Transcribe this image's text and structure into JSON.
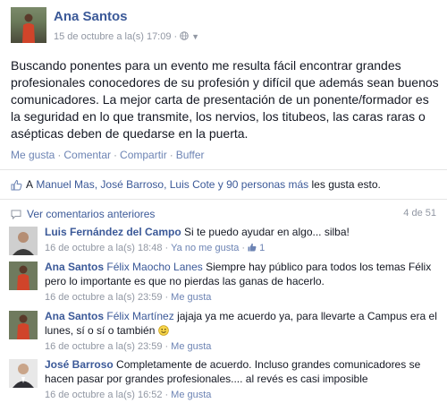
{
  "post": {
    "author": "Ana Santos",
    "timestamp": "15 de octubre a la(s) 17:09",
    "separator": "·",
    "text": "Buscando ponentes para un evento me resulta fácil encontrar grandes profesionales conocedores de su profesión y difícil que además sean buenos comunicadores. La mejor carta de presentación de un ponente/formador es la seguridad en lo que transmite, los nervios, los titubeos, las caras raras o asépticas deben de quedarse en la puerta.",
    "actions": [
      "Me gusta",
      "Comentar",
      "Compartir",
      "Buffer"
    ],
    "likes_prefix": "A",
    "likes_names": "Manuel Mas, José Barroso, Luis Cote y 90 personas más",
    "likes_suffix": "les gusta esto.",
    "view_previous": "Ver comentarios anteriores",
    "comment_count": "4 de 51"
  },
  "comments": [
    {
      "author": "Luis Fernández del Campo",
      "tag": "",
      "text": "Si te puedo ayudar en algo... silba!",
      "timestamp": "16 de octubre a la(s) 18:48",
      "action": "Ya no me gusta",
      "likes": "1"
    },
    {
      "author": "Ana Santos",
      "tag": "Félix Maocho Lanes",
      "text": "Siempre hay público para todos los temas Félix pero lo importante es que no pierdas las ganas de hacerlo.",
      "timestamp": "16 de octubre a la(s) 23:59",
      "action": "Me gusta"
    },
    {
      "author": "Ana Santos",
      "tag": "Félix Martínez",
      "text": "jajaja ya me acuerdo ya, para llevarte a Campus era el lunes, sí o sí o también",
      "timestamp": "16 de octubre a la(s) 23:59",
      "action": "Me gusta"
    },
    {
      "author": "José Barroso",
      "tag": "",
      "text": "Completamente de acuerdo. Incluso grandes comunicadores se hacen pasar por grandes profesionales.... al revés es casi imposible",
      "timestamp": "16 de octubre a la(s) 16:52",
      "action": "Me gusta"
    }
  ],
  "colors": {
    "link": "#3b5998",
    "muted": "#9197a3",
    "text": "#141823"
  }
}
